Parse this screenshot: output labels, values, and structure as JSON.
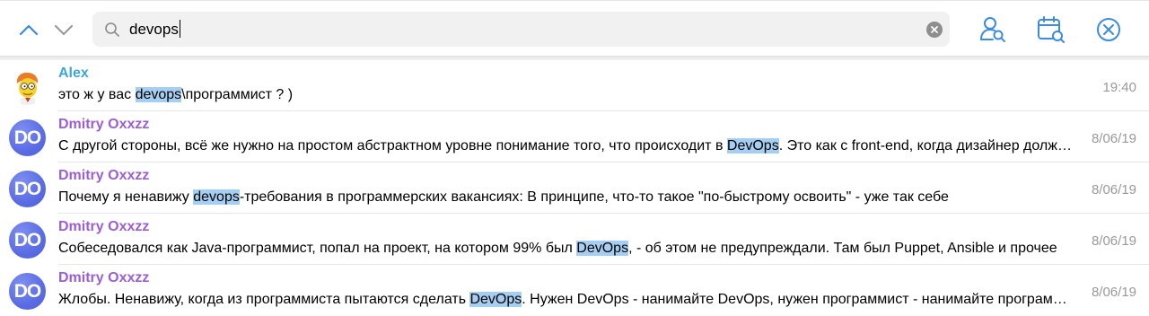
{
  "search": {
    "query": "devops"
  },
  "colors": {
    "accent": "#3d8be0",
    "highlight": "#a5cff2",
    "name_alex": "#3ca6d8",
    "name_dmitry": "#9a5fd6",
    "avatar_do": "#5a6ce4"
  },
  "icons": {
    "prev": "chevron-up-icon",
    "next": "chevron-down-icon",
    "search": "search-icon",
    "clear": "clear-icon",
    "from_user": "search-by-user-icon",
    "by_date": "search-by-date-icon",
    "close": "close-icon"
  },
  "results": [
    {
      "sender": "Alex",
      "avatar": "",
      "text_before": "это ж у вас ",
      "match": "devops",
      "text_after": "\\программист ? )",
      "date": "19:40"
    },
    {
      "sender": "Dmitry Oxxzz",
      "avatar": "DO",
      "text_before": "С другой стороны, всё же нужно на простом абстрактном уровне понимание того, что происходит в ",
      "match": "DevOps",
      "text_after": ". Это как с front-end, когда дизайнер должен понимать, как работает верстка",
      "date": "8/06/19"
    },
    {
      "sender": "Dmitry Oxxzz",
      "avatar": "DO",
      "text_before": "Почему я ненавижу ",
      "match": "devops",
      "text_after": "-требования в программерских вакансиях: В принципе, что-то такое \"по-быстрому освоить\" - уже так себе",
      "date": "8/06/19"
    },
    {
      "sender": "Dmitry Oxxzz",
      "avatar": "DO",
      "text_before": "Собеседовался как Java-программист, попал на проект, на котором 99% был ",
      "match": "DevOps",
      "text_after": ", - об этом не предупреждали. Там был Puppet, Ansible и прочее",
      "date": "8/06/19"
    },
    {
      "sender": "Dmitry Oxxzz",
      "avatar": "DO",
      "text_before": "Жлобы. Ненавижу, когда из программиста пытаются сделать ",
      "match": "DevOps",
      "text_after": ". Нужен DevOps - нанимайте DevOps, нужен программист - нанимайте программиста",
      "date": "8/06/19"
    }
  ]
}
